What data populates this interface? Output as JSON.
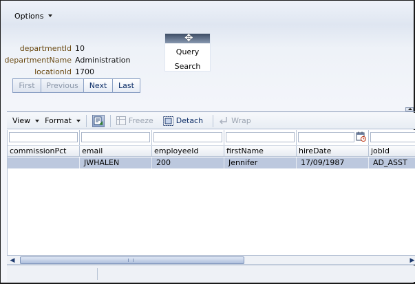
{
  "options_menu": {
    "label": "Options"
  },
  "form": {
    "fields": [
      {
        "label": "departmentId",
        "value": "10"
      },
      {
        "label": "departmentName",
        "value": "Administration"
      },
      {
        "label": "locationId",
        "value": "1700"
      }
    ]
  },
  "navigation": {
    "first": "First",
    "previous": "Previous",
    "next": "Next",
    "last": "Last"
  },
  "query_popup": {
    "query": "Query",
    "search": "Search"
  },
  "toolbar": {
    "view": "View",
    "format": "Format",
    "freeze": "Freeze",
    "detach": "Detach",
    "wrap": "Wrap"
  },
  "table": {
    "columns": [
      "commissionPct",
      "email",
      "employeeId",
      "firstName",
      "hireDate",
      "jobId"
    ],
    "rows": [
      [
        "",
        "JWHALEN",
        "200",
        "Jennifer",
        "17/09/1987",
        "AD_ASST"
      ]
    ]
  },
  "colors": {
    "accent": "#0b2c66",
    "label": "#6b4a12",
    "selected_row": "#bcc8de"
  }
}
